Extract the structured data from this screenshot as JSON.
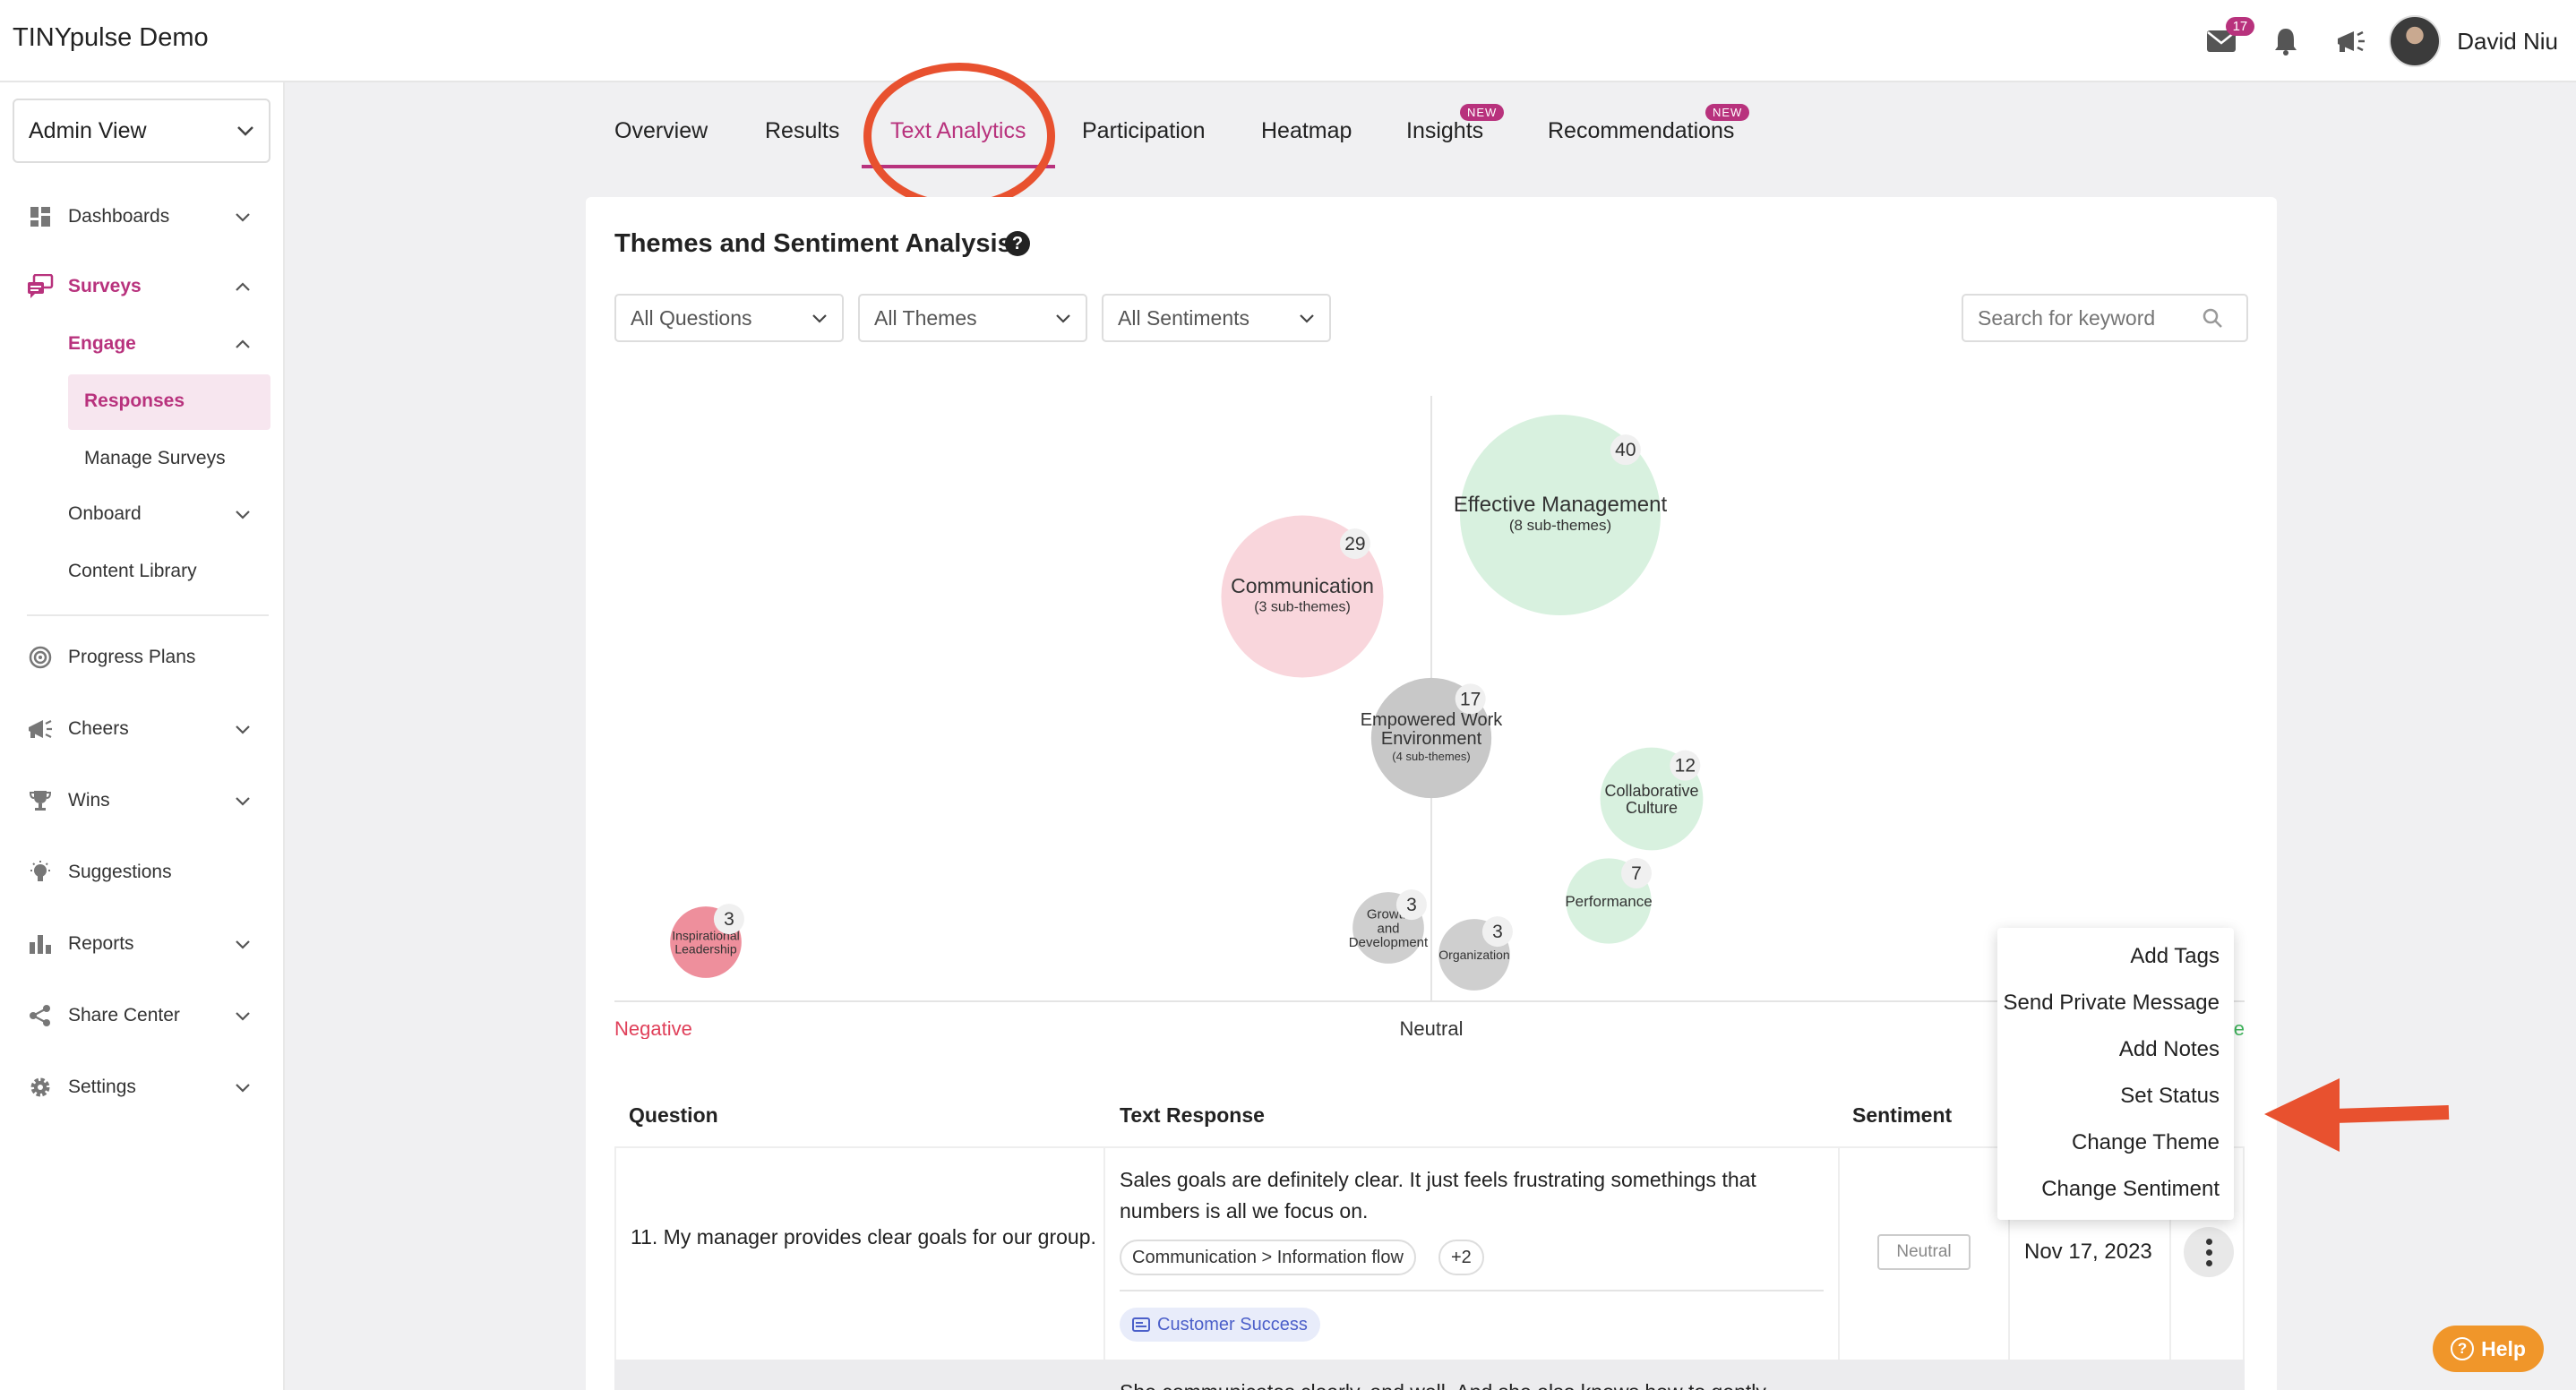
{
  "app": {
    "title": "TINYpulse Demo"
  },
  "topbar": {
    "mail_count": "17",
    "user_name": "David Niu"
  },
  "sidebar": {
    "view_select": "Admin View",
    "items": [
      {
        "label": "Dashboards"
      },
      {
        "label": "Surveys"
      },
      {
        "label": "Engage"
      },
      {
        "label": "Responses"
      },
      {
        "label": "Manage Surveys"
      },
      {
        "label": "Onboard"
      },
      {
        "label": "Content Library"
      },
      {
        "label": "Progress Plans"
      },
      {
        "label": "Cheers"
      },
      {
        "label": "Wins"
      },
      {
        "label": "Suggestions"
      },
      {
        "label": "Reports"
      },
      {
        "label": "Share Center"
      },
      {
        "label": "Settings"
      }
    ]
  },
  "tabs": [
    {
      "label": "Overview"
    },
    {
      "label": "Results"
    },
    {
      "label": "Text Analytics"
    },
    {
      "label": "Participation"
    },
    {
      "label": "Heatmap"
    },
    {
      "label": "Insights",
      "badge": "NEW"
    },
    {
      "label": "Recommendations",
      "badge": "NEW"
    }
  ],
  "analysis": {
    "title": "Themes and Sentiment Analysis",
    "help_glyph": "?",
    "filters": {
      "questions": "All Questions",
      "themes": "All Themes",
      "sentiments": "All Sentiments"
    },
    "search_placeholder": "Search for keyword"
  },
  "chart_data": {
    "type": "scatter",
    "axis_labels": {
      "left": "Negative",
      "center": "Neutral",
      "right": "Positive"
    },
    "themes": [
      {
        "name": "Effective Management",
        "subtitle": "(8 sub-themes)",
        "count": 40,
        "sentiment": 0.24,
        "color": "#d8f1df"
      },
      {
        "name": "Communication",
        "subtitle": "(3 sub-themes)",
        "count": 29,
        "sentiment": -0.24,
        "color": "#f9d6dc"
      },
      {
        "name": "Empowered Work Environment",
        "subtitle": "(4 sub-themes)",
        "count": 17,
        "sentiment": 0.0,
        "color": "#c8c8c8"
      },
      {
        "name": "Collaborative Culture",
        "subtitle": "",
        "count": 12,
        "sentiment": 0.41,
        "color": "#d8f1df"
      },
      {
        "name": "Performance",
        "subtitle": "",
        "count": 7,
        "sentiment": 0.33,
        "color": "#d8f1df"
      },
      {
        "name": "Growth and Development",
        "subtitle": "",
        "count": 3,
        "sentiment": -0.08,
        "color": "#cfcfcf"
      },
      {
        "name": "Organization",
        "subtitle": "",
        "count": 3,
        "sentiment": 0.08,
        "color": "#cfcfcf"
      },
      {
        "name": "Inspirational Leadership",
        "subtitle": "",
        "count": 3,
        "sentiment": -1.35,
        "color": "#ee8f9c"
      }
    ]
  },
  "table": {
    "headers": {
      "question": "Question",
      "text": "Text Response",
      "sentiment": "Sentiment"
    },
    "rows": [
      {
        "question": "11. My manager provides clear goals for our group.",
        "text": "Sales goals are definitely clear. It just feels frustrating somethings that numbers is all we focus on.",
        "tag": "Communication > Information flow",
        "more_tags": "+2",
        "department": "Customer Success",
        "sentiment": "Neutral",
        "date": "Nov 17, 2023"
      },
      {
        "text": "She communicates clearly, and well. And she also knows how to gently but"
      }
    ]
  },
  "context_menu": {
    "items": [
      "Add Tags",
      "Send Private Message",
      "Add Notes",
      "Set Status",
      "Change Theme",
      "Change Sentiment"
    ]
  },
  "help_button": {
    "label": "Help",
    "glyph": "?"
  },
  "colors": {
    "accent": "#b8327d",
    "annotation": "#e8512f",
    "negative": "#e0405a",
    "positive": "#3fb55c",
    "help": "#f0962a"
  }
}
